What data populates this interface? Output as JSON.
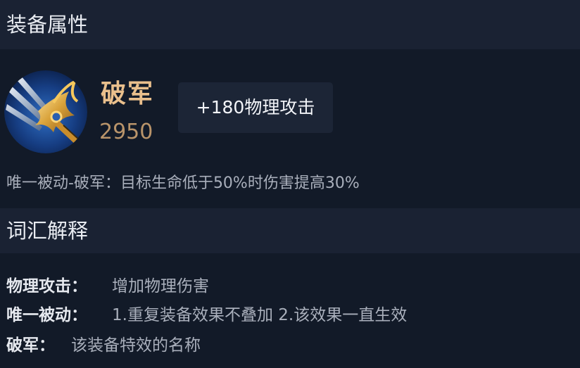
{
  "sections": {
    "attributes_title": "装备属性",
    "glossary_title": "词汇解释"
  },
  "item": {
    "icon": "broken-army-trident-icon",
    "name": "破军",
    "price": "2950",
    "stat": "+180物理攻击",
    "passive": "唯一被动-破军：目标生命低于50%时伤害提高30%"
  },
  "glossary": [
    {
      "term": "物理攻击：",
      "definition": "增加物理伤害"
    },
    {
      "term": "唯一被动：",
      "definition": "1.重复装备效果不叠加 2.该效果一直生效"
    },
    {
      "term": "破军：",
      "definition": "该装备特效的名称"
    }
  ],
  "colors": {
    "background": "#121a28",
    "header_bg": "#1a2233",
    "item_name": "#e9bf8c",
    "price": "#b9946a",
    "stat_box_bg": "#1c2536"
  }
}
